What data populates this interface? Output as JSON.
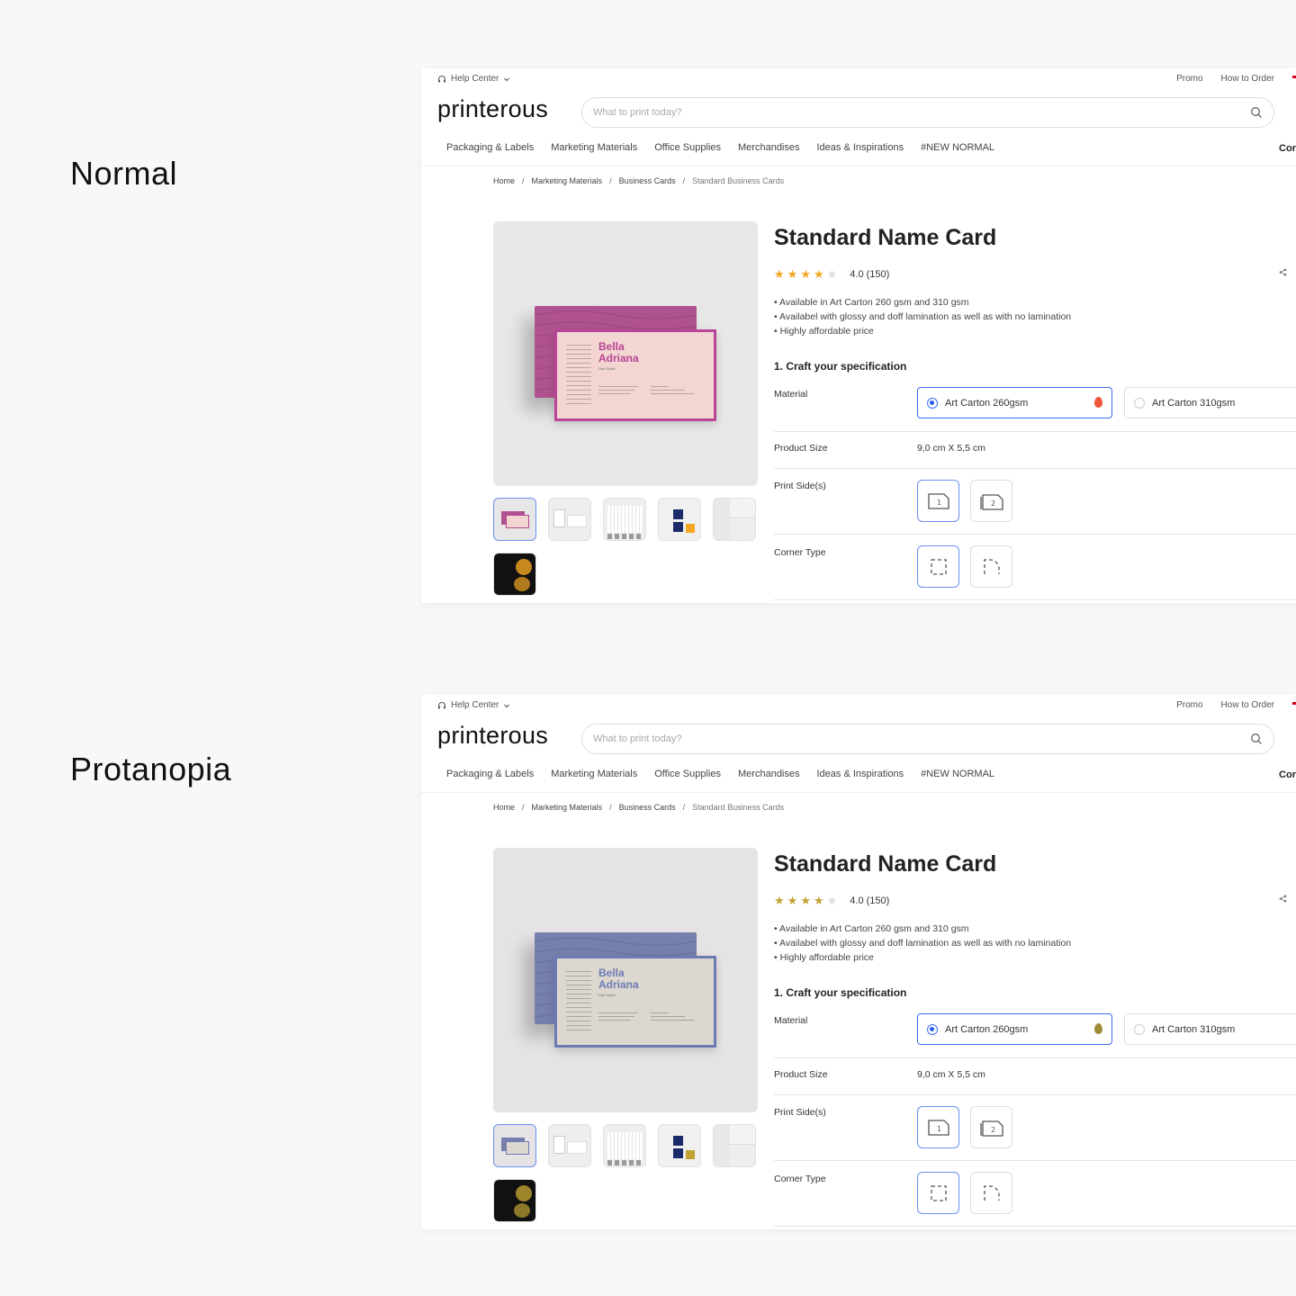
{
  "labels": {
    "normal": "Normal",
    "protanopia": "Protanopia"
  },
  "site": {
    "help_center": "Help Center",
    "top_links": [
      "Promo",
      "How to Order"
    ],
    "logo": "printerous",
    "search_placeholder": "What to print today?",
    "nav": [
      "Packaging & Labels",
      "Marketing Materials",
      "Office Supplies",
      "Merchandises",
      "Ideas & Inspirations",
      "#NEW NORMAL"
    ],
    "nav_right": "Cor",
    "breadcrumb": [
      "Home",
      "Marketing Materials",
      "Business Cards",
      "Standard Business Cards"
    ],
    "breadcrumb_sep": "/"
  },
  "card_mock": {
    "name_line1": "Bella",
    "name_line2": "Adriana",
    "role": "Nail Stylist"
  },
  "product": {
    "title": "Standard Name Card",
    "rating_value": 4,
    "rating_max": 5,
    "rating_text": "4.0 (150)",
    "share": "<",
    "bullets": [
      "• Available in Art Carton 260 gsm and 310 gsm",
      "• Availabel with glossy and doff lamination as well as with no lamination",
      "• Highly affordable price"
    ],
    "spec_title": "1. Craft your specification",
    "material_label": "Material",
    "material_options": [
      "Art Carton 260gsm",
      "Art Carton 310gsm"
    ],
    "size_label": "Product Size",
    "size_value": "9,0 cm X 5,5 cm",
    "print_sides_label": "Print Side(s)",
    "print_sides": [
      "1",
      "2"
    ],
    "corner_label": "Corner Type"
  },
  "colors": {
    "normal": {
      "bg": "#e7e7e7",
      "back": "#b0528f",
      "front": "#f3d5d2",
      "border": "#b84596",
      "name": "#b84596",
      "star": "#f5a623",
      "flame": "#f0553a"
    },
    "protanopia": {
      "bg": "#e5e3e4",
      "back": "#7680ac",
      "front": "#dcd8cf",
      "border": "#6d7bb5",
      "name": "#6d7bb5",
      "star": "#c2a232",
      "flame": "#9f8b3a"
    }
  }
}
